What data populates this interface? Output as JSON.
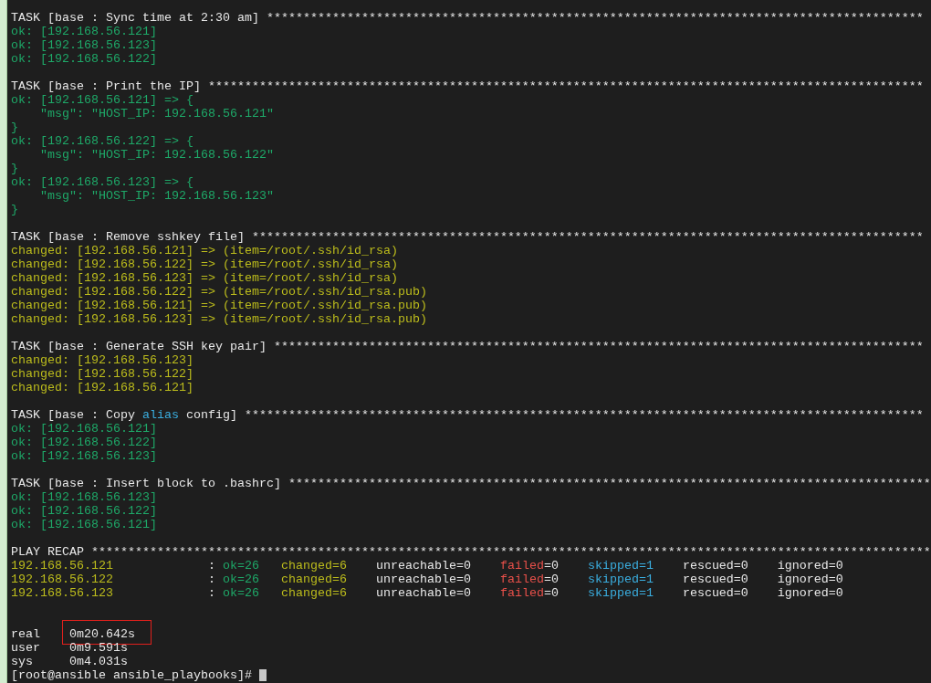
{
  "terminal": {
    "lines": [
      {
        "kind": "text",
        "segments": [
          {
            "text": "TASK [base : Sync time at 2:30 am] ******************************************************************************************",
            "color": "#e8e8e8"
          }
        ]
      },
      {
        "kind": "text",
        "segments": [
          {
            "text": "ok: [192.168.56.121]",
            "color": "#1ea868"
          }
        ]
      },
      {
        "kind": "text",
        "segments": [
          {
            "text": "ok: [192.168.56.123]",
            "color": "#1ea868"
          }
        ]
      },
      {
        "kind": "text",
        "segments": [
          {
            "text": "ok: [192.168.56.122]",
            "color": "#1ea868"
          }
        ]
      },
      {
        "kind": "blank"
      },
      {
        "kind": "text",
        "segments": [
          {
            "text": "TASK [base : Print the IP] **************************************************************************************************",
            "color": "#e8e8e8"
          }
        ]
      },
      {
        "kind": "text",
        "segments": [
          {
            "text": "ok: [192.168.56.121] => {",
            "color": "#1ea868"
          }
        ]
      },
      {
        "kind": "text",
        "indented": true,
        "segments": [
          {
            "text": "\"msg\": \"HOST_IP: 192.168.56.121\"",
            "color": "#1ea868"
          }
        ]
      },
      {
        "kind": "text",
        "segments": [
          {
            "text": "}",
            "color": "#1ea868"
          }
        ]
      },
      {
        "kind": "text",
        "segments": [
          {
            "text": "ok: [192.168.56.122] => {",
            "color": "#1ea868"
          }
        ]
      },
      {
        "kind": "text",
        "indented": true,
        "segments": [
          {
            "text": "\"msg\": \"HOST_IP: 192.168.56.122\"",
            "color": "#1ea868"
          }
        ]
      },
      {
        "kind": "text",
        "segments": [
          {
            "text": "}",
            "color": "#1ea868"
          }
        ]
      },
      {
        "kind": "text",
        "segments": [
          {
            "text": "ok: [192.168.56.123] => {",
            "color": "#1ea868"
          }
        ]
      },
      {
        "kind": "text",
        "indented": true,
        "segments": [
          {
            "text": "\"msg\": \"HOST_IP: 192.168.56.123\"",
            "color": "#1ea868"
          }
        ]
      },
      {
        "kind": "text",
        "segments": [
          {
            "text": "}",
            "color": "#1ea868"
          }
        ]
      },
      {
        "kind": "blank"
      },
      {
        "kind": "text",
        "segments": [
          {
            "text": "TASK [base : Remove sshkey file] ********************************************************************************************",
            "color": "#e8e8e8"
          }
        ]
      },
      {
        "kind": "text",
        "segments": [
          {
            "text": "changed: [192.168.56.121] => (item=/root/.ssh/id_rsa)",
            "color": "#bcbc1c"
          }
        ]
      },
      {
        "kind": "text",
        "segments": [
          {
            "text": "changed: [192.168.56.122] => (item=/root/.ssh/id_rsa)",
            "color": "#bcbc1c"
          }
        ]
      },
      {
        "kind": "text",
        "segments": [
          {
            "text": "changed: [192.168.56.123] => (item=/root/.ssh/id_rsa)",
            "color": "#bcbc1c"
          }
        ]
      },
      {
        "kind": "text",
        "segments": [
          {
            "text": "changed: [192.168.56.122] => (item=/root/.ssh/id_rsa.pub)",
            "color": "#bcbc1c"
          }
        ]
      },
      {
        "kind": "text",
        "segments": [
          {
            "text": "changed: [192.168.56.121] => (item=/root/.ssh/id_rsa.pub)",
            "color": "#bcbc1c"
          }
        ]
      },
      {
        "kind": "text",
        "segments": [
          {
            "text": "changed: [192.168.56.123] => (item=/root/.ssh/id_rsa.pub)",
            "color": "#bcbc1c"
          }
        ]
      },
      {
        "kind": "blank"
      },
      {
        "kind": "text",
        "segments": [
          {
            "text": "TASK [base : Generate SSH key pair] *****************************************************************************************",
            "color": "#e8e8e8"
          }
        ]
      },
      {
        "kind": "text",
        "segments": [
          {
            "text": "changed: [192.168.56.123]",
            "color": "#bcbc1c"
          }
        ]
      },
      {
        "kind": "text",
        "segments": [
          {
            "text": "changed: [192.168.56.122]",
            "color": "#bcbc1c"
          }
        ]
      },
      {
        "kind": "text",
        "segments": [
          {
            "text": "changed: [192.168.56.121]",
            "color": "#bcbc1c"
          }
        ]
      },
      {
        "kind": "blank"
      },
      {
        "kind": "text",
        "segments": [
          {
            "text": "TASK [base : Copy ",
            "color": "#e8e8e8"
          },
          {
            "text": "alias",
            "color": "#3aaee0"
          },
          {
            "text": " config] *********************************************************************************************",
            "color": "#e8e8e8"
          }
        ]
      },
      {
        "kind": "text",
        "segments": [
          {
            "text": "ok: [192.168.56.121]",
            "color": "#1ea868"
          }
        ]
      },
      {
        "kind": "text",
        "segments": [
          {
            "text": "ok: [192.168.56.122]",
            "color": "#1ea868"
          }
        ]
      },
      {
        "kind": "text",
        "segments": [
          {
            "text": "ok: [192.168.56.123]",
            "color": "#1ea868"
          }
        ]
      },
      {
        "kind": "blank"
      },
      {
        "kind": "text",
        "segments": [
          {
            "text": "TASK [base : Insert block to .bashrc] ****************************************************************************************",
            "color": "#e8e8e8"
          }
        ]
      },
      {
        "kind": "text",
        "segments": [
          {
            "text": "ok: [192.168.56.123]",
            "color": "#1ea868"
          }
        ]
      },
      {
        "kind": "text",
        "segments": [
          {
            "text": "ok: [192.168.56.122]",
            "color": "#1ea868"
          }
        ]
      },
      {
        "kind": "text",
        "segments": [
          {
            "text": "ok: [192.168.56.121]",
            "color": "#1ea868"
          }
        ]
      },
      {
        "kind": "blank"
      },
      {
        "kind": "text",
        "segments": [
          {
            "text": "PLAY RECAP *******************************************************************************************************************",
            "color": "#e8e8e8"
          }
        ]
      },
      {
        "kind": "text",
        "segments": [
          {
            "text": "192.168.56.121             ",
            "color": "#bcbc1c"
          },
          {
            "text": ": "
          },
          {
            "text": "ok=26   ",
            "color": "#1ea868"
          },
          {
            "text": "changed=6",
            "color": "#bcbc1c"
          },
          {
            "text": "    unreachable=0    ",
            "color": "#e8e8e8"
          },
          {
            "text": "failed",
            "color": "#e8504a"
          },
          {
            "text": "=0    ",
            "color": "#e8e8e8"
          },
          {
            "text": "skipped=1",
            "color": "#3aaee0"
          },
          {
            "text": "    rescued=0    ignored=0",
            "color": "#e8e8e8"
          }
        ]
      },
      {
        "kind": "text",
        "segments": [
          {
            "text": "192.168.56.122             ",
            "color": "#bcbc1c"
          },
          {
            "text": ": "
          },
          {
            "text": "ok=26   ",
            "color": "#1ea868"
          },
          {
            "text": "changed=6",
            "color": "#bcbc1c"
          },
          {
            "text": "    unreachable=0    ",
            "color": "#e8e8e8"
          },
          {
            "text": "failed",
            "color": "#e8504a"
          },
          {
            "text": "=0    ",
            "color": "#e8e8e8"
          },
          {
            "text": "skipped=1",
            "color": "#3aaee0"
          },
          {
            "text": "    rescued=0    ignored=0",
            "color": "#e8e8e8"
          }
        ]
      },
      {
        "kind": "text",
        "segments": [
          {
            "text": "192.168.56.123             ",
            "color": "#bcbc1c"
          },
          {
            "text": ": "
          },
          {
            "text": "ok=26   ",
            "color": "#1ea868"
          },
          {
            "text": "changed=6",
            "color": "#bcbc1c"
          },
          {
            "text": "    unreachable=0    ",
            "color": "#e8e8e8"
          },
          {
            "text": "failed",
            "color": "#e8504a"
          },
          {
            "text": "=0    ",
            "color": "#e8e8e8"
          },
          {
            "text": "skipped=1",
            "color": "#3aaee0"
          },
          {
            "text": "    rescued=0    ignored=0",
            "color": "#e8e8e8"
          }
        ]
      },
      {
        "kind": "blank"
      },
      {
        "kind": "blank"
      },
      {
        "kind": "timing",
        "label": "real",
        "value": "0m20.642s",
        "highlighted": true
      },
      {
        "kind": "timing",
        "label": "user",
        "value": "0m9.591s",
        "highlighted": false
      },
      {
        "kind": "timing",
        "label": "sys",
        "value": "0m4.031s",
        "highlighted": false
      },
      {
        "kind": "prompt",
        "text": "[root@ansible ansible_playbooks]#",
        "cursor": true
      }
    ]
  }
}
